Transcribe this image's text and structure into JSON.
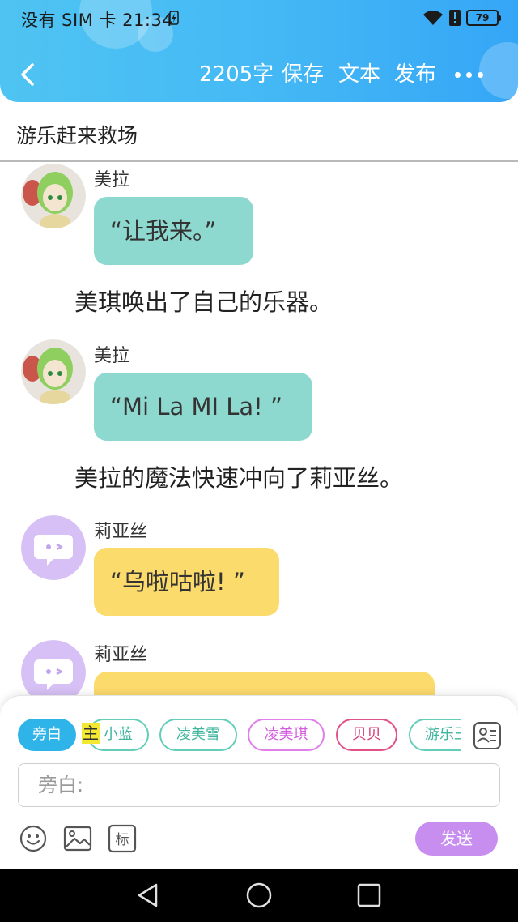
{
  "status_bar": {
    "carrier_time": "没有 SIM 卡 21:34",
    "battery_level": "79",
    "icons": [
      "charging-icon",
      "wifi-icon",
      "alert-icon",
      "battery-icon"
    ]
  },
  "toolbar": {
    "word_count": "2205字",
    "save_label": "保存",
    "text_label": "文本",
    "publish_label": "发布"
  },
  "story": {
    "title": "游乐赶来救场"
  },
  "messages": [
    {
      "speaker": "美拉",
      "text": "“让我来。”"
    },
    {
      "narration": "美琪唤出了自己的乐器。"
    },
    {
      "speaker": "美拉",
      "text": "“Mi La MI La! ”"
    },
    {
      "narration": "美拉的魔法快速冲向了莉亚丝。"
    },
    {
      "speaker": "莉亚丝",
      "text": "“乌啦咕啦! ”"
    },
    {
      "speaker": "莉亚丝",
      "text": ""
    }
  ],
  "characters": [
    "旁白",
    "小蓝",
    "凌美雪",
    "凌美琪",
    "贝贝",
    "游乐王子"
  ],
  "selection_mark": "主",
  "input": {
    "placeholder": "旁白:"
  },
  "send_label": "发送",
  "colors": {
    "header_blue": "#45b9f5",
    "bubble_teal": "#8ed9cf",
    "bubble_yellow": "#fcdb6d",
    "send_purple": "#c78ef0",
    "chip_active": "#2fb4ea"
  }
}
